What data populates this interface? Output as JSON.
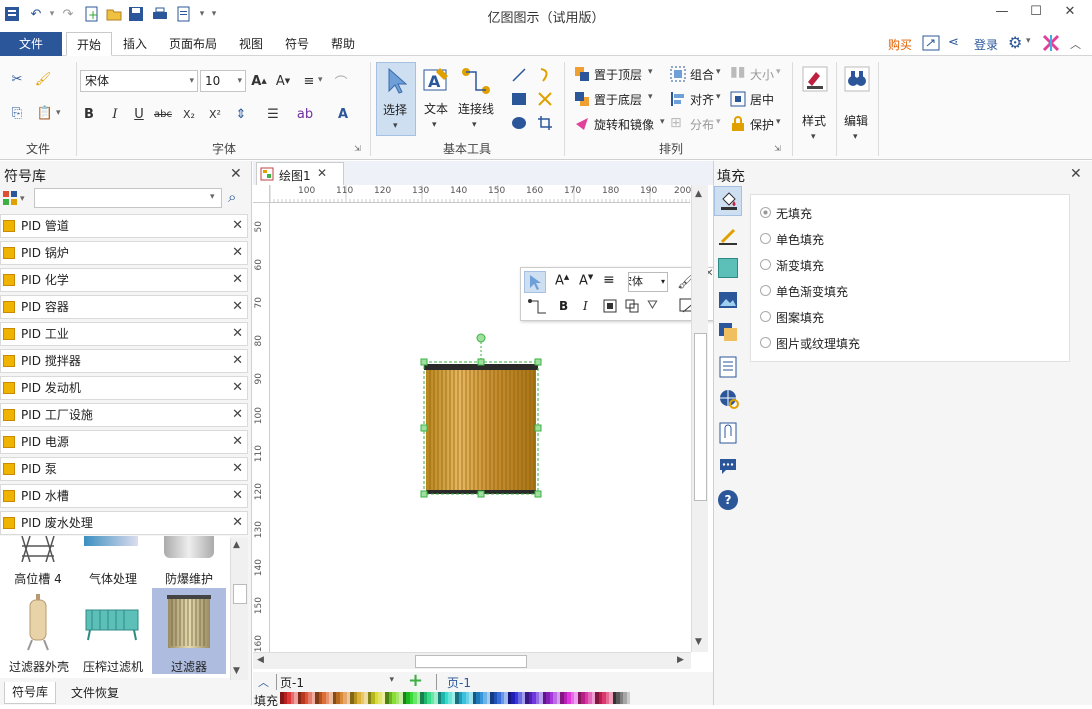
{
  "app": {
    "title": "亿图图示（试用版）"
  },
  "menu": {
    "file": "文件",
    "tabs": [
      "开始",
      "插入",
      "页面布局",
      "视图",
      "符号",
      "帮助"
    ],
    "buy": "购买",
    "login": "登录"
  },
  "ribbon": {
    "groups": {
      "file": "文件",
      "font": "字体",
      "basic_tools": "基本工具",
      "arrange": "排列"
    },
    "font_name": "宋体",
    "font_size": "10",
    "select": "选择",
    "text": "文本",
    "connector": "连接线",
    "bring_front": "置于顶层",
    "send_back": "置于底层",
    "rotate_mirror": "旋转和镜像",
    "group": "组合",
    "align": "对齐",
    "distribute": "分布",
    "size": "大小",
    "center": "居中",
    "protect": "保护",
    "style": "样式",
    "edit": "编辑"
  },
  "left_panel": {
    "title": "符号库",
    "search_placeholder": "",
    "libraries": [
      "PID 管道",
      "PID 锅炉",
      "PID 化学",
      "PID 容器",
      "PID 工业",
      "PID 搅拌器",
      "PID 发动机",
      "PID 工厂设施",
      "PID 电源",
      "PID 泵",
      "PID 水槽",
      "PID 废水处理"
    ],
    "shapes": [
      "高位槽 4",
      "气体处理",
      "防爆维护",
      "过滤器外壳",
      "压榨过滤机",
      "过滤器"
    ],
    "bottom_tabs": [
      "符号库",
      "文件恢复"
    ]
  },
  "document": {
    "tab": "绘图1",
    "ruler_h": [
      "100",
      "110",
      "120",
      "130",
      "140",
      "150",
      "160",
      "170",
      "180",
      "190",
      "200"
    ],
    "ruler_v": [
      "50",
      "60",
      "70",
      "80",
      "90",
      "100",
      "110",
      "120",
      "130",
      "140",
      "150",
      "160"
    ],
    "mini_toolbar_font": "宋体"
  },
  "pages": {
    "selector": "页-1",
    "current": "页-1",
    "fill_label": "填充"
  },
  "right_panel": {
    "title": "填充",
    "options": [
      "无填充",
      "单色填充",
      "渐变填充",
      "单色渐变填充",
      "图案填充",
      "图片或纹理填充"
    ],
    "selected": 0
  },
  "colors": {
    "accent": "#2b579a",
    "selection": "#3cb043",
    "buy": "#e06000"
  }
}
